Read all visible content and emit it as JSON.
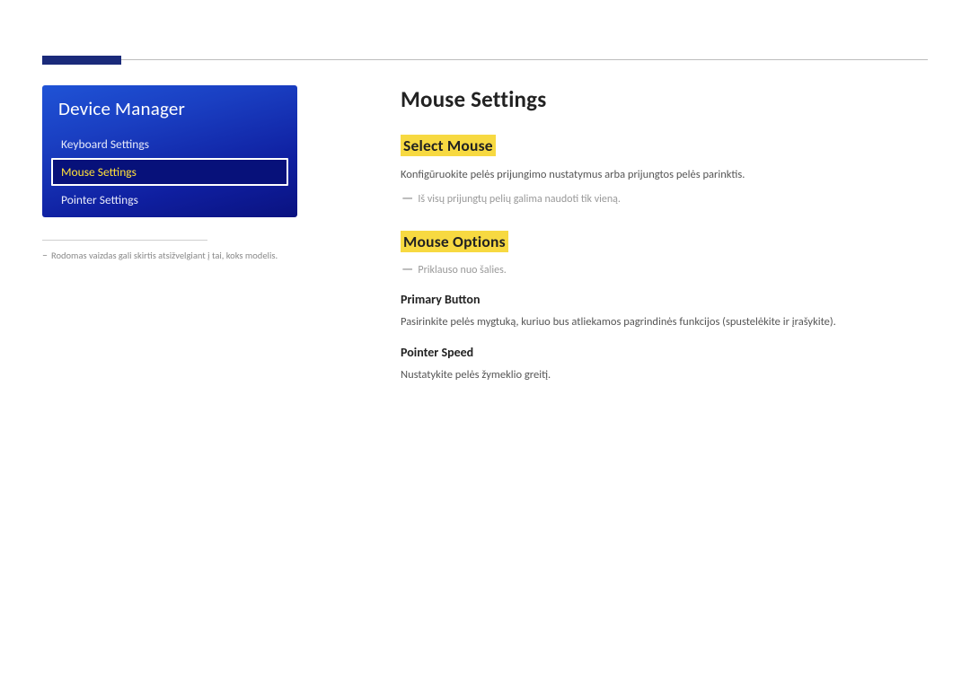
{
  "sidebar": {
    "title": "Device Manager",
    "items": [
      {
        "label": "Keyboard Settings",
        "selected": false
      },
      {
        "label": "Mouse Settings",
        "selected": true
      },
      {
        "label": "Pointer Settings",
        "selected": false
      }
    ],
    "footnote": "Rodomas vaizdas gali skirtis atsižvelgiant į tai, koks modelis."
  },
  "main": {
    "title": "Mouse Settings",
    "sections": {
      "select_mouse": {
        "heading": "Select Mouse",
        "body": "Konfigūruokite pelės prijungimo nustatymus arba prijungtos pelės parinktis.",
        "note": "Iš visų prijungtų pelių galima naudoti tik vieną."
      },
      "mouse_options": {
        "heading": "Mouse Options",
        "note": "Priklauso nuo šalies.",
        "primary_button": {
          "heading": "Primary Button",
          "body": "Pasirinkite pelės mygtuką, kuriuo bus atliekamos pagrindinės funkcijos (spustelėkite ir įrašykite)."
        },
        "pointer_speed": {
          "heading": "Pointer Speed",
          "body": "Nustatykite pelės žymeklio greitį."
        }
      }
    }
  }
}
